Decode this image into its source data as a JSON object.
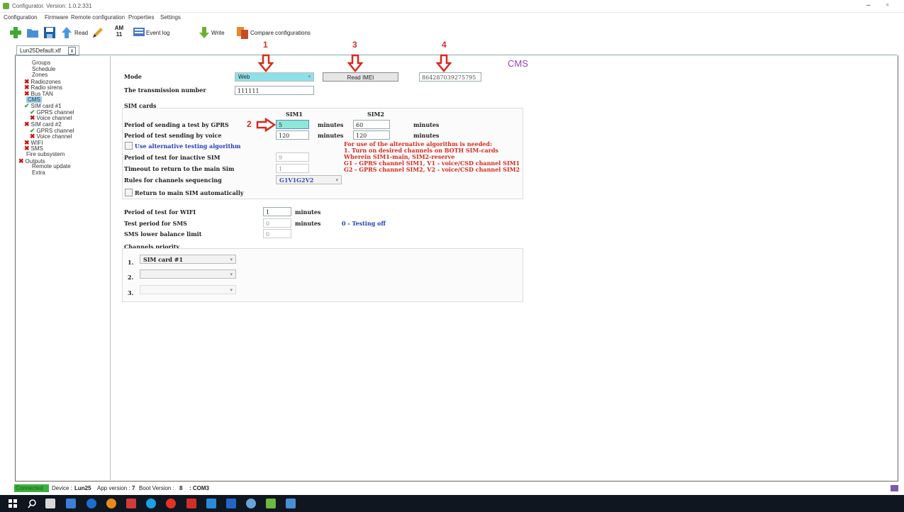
{
  "window": {
    "title": "Configurator. Version: 1.0.2.331",
    "minimize": "–",
    "maximize": "▫"
  },
  "menu": [
    "Configuration",
    "Firmware",
    "Remote configuration",
    "Properties",
    "Settings"
  ],
  "toolbar": {
    "read_label": "Read",
    "am_top": "AM",
    "am_bottom": "11",
    "event_log_label": "Event log",
    "write_label": "Write",
    "compare_label": "Compare configurations"
  },
  "tab": {
    "title": "Lun25Default.xlf",
    "close": "x"
  },
  "sidebar": {
    "items": [
      {
        "label": "Groups",
        "mark": "",
        "indent": 1
      },
      {
        "label": "Schedule",
        "mark": "",
        "indent": 1
      },
      {
        "label": "Zones",
        "mark": "",
        "indent": 1
      },
      {
        "label": "Radiozones",
        "mark": "x",
        "indent": 1
      },
      {
        "label": "Radio sirens",
        "mark": "x",
        "indent": 1
      },
      {
        "label": "Bus TAN",
        "mark": "x",
        "indent": 1
      },
      {
        "label": "CMS",
        "mark": "",
        "indent": 0,
        "selected": true
      },
      {
        "label": "SIM card #1",
        "mark": "ok",
        "indent": 1
      },
      {
        "label": "GPRS channel",
        "mark": "ok",
        "indent": 2
      },
      {
        "label": "Voice channel",
        "mark": "x",
        "indent": 2
      },
      {
        "label": "SIM card #2",
        "mark": "x",
        "indent": 1
      },
      {
        "label": "GPRS channel",
        "mark": "ok",
        "indent": 2
      },
      {
        "label": "Voice channel",
        "mark": "x",
        "indent": 2
      },
      {
        "label": "WIFI",
        "mark": "x",
        "indent": 1
      },
      {
        "label": "SMS",
        "mark": "x",
        "indent": 1
      },
      {
        "label": "Fire subsystem",
        "mark": "",
        "indent": 0
      },
      {
        "label": "Outputs",
        "mark": "x",
        "indent": 0
      },
      {
        "label": "Remote update",
        "mark": "",
        "indent": 1
      },
      {
        "label": "Extra",
        "mark": "",
        "indent": 1
      }
    ]
  },
  "annotations": {
    "n1": "1",
    "n2": "2",
    "n3": "3",
    "n4": "4"
  },
  "main": {
    "section_title": "CMS",
    "mode_label": "Mode",
    "mode_value": "Web",
    "read_imei_button": "Read IMEI",
    "imei_value": "864287039275795",
    "transmission_label": "The transmission number",
    "transmission_value": "111111",
    "sim_cards_title": "SIM cards",
    "sim1_header": "SIM1",
    "sim2_header": "SIM2",
    "gprs_period_label": "Period of sending a test by GPRS",
    "gprs_sim1": "5",
    "gprs_sim2": "60",
    "voice_period_label": "Period of test sending by voice",
    "voice_sim1": "120",
    "voice_sim2": "120",
    "minutes": "minutes",
    "alt_algo_label": "Use alternative testing algorithm",
    "inactive_label": "Period of test for inactive SIM",
    "inactive_value": "9",
    "timeout_label": "Timeout to return to the main Sim",
    "timeout_value": "1",
    "rules_label": "Rules for channels sequencing",
    "rules_value": "G1V1G2V2",
    "return_label": "Return to main SIM automatically",
    "note_lines": [
      "For use of the alternative algorithm is needed:",
      "1. Turn on desired channels on BOTH SIM-cards",
      "Wherein SIM1-main, SIM2-reserve",
      "G1 - GPRS channel SIM1, V1 - voice/CSD channel SIM1",
      "G2 - GPRS channel SIM2, V2 - voice/CSD channel SIM2"
    ],
    "wifi_label": "Period of test for WIFI",
    "wifi_value": "1",
    "sms_label": "Test period for SMS",
    "sms_value": "0",
    "testing_off": "0 - Testing off",
    "sms_balance_label": "SMS lower balance limit",
    "sms_balance_value": "0",
    "channels_title": "Channels priority",
    "priority": [
      {
        "n": "1.",
        "value": "SIM card #1"
      },
      {
        "n": "2.",
        "value": ""
      },
      {
        "n": "3.",
        "value": ""
      }
    ]
  },
  "status": {
    "connected": "Connected",
    "device_label": "Device :",
    "device_value": "Lun25",
    "app_label": "App version :",
    "app_value": "7",
    "boot_label": "Boot Version :",
    "boot_value": "8",
    "port": ": COM3"
  }
}
